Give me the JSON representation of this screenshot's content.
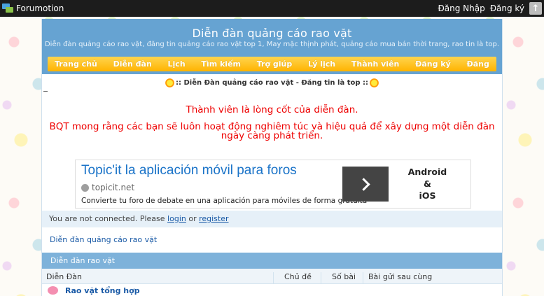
{
  "topbar": {
    "brand": "Forumotion",
    "login": "Đăng Nhập",
    "register": "Đăng ký",
    "up_symbol": "↑"
  },
  "header": {
    "title": "Diễn đàn quảng cáo rao vặt",
    "description": "Diễn đàn quảng cáo rao vặt, đăng tin quảng cáo rao vặt top 1, May mặc thịnh phát, quảng cáo mua bán thời trang, rao tin là top."
  },
  "nav": {
    "items": [
      "Trang chủ",
      "Diễn đàn",
      "Lịch",
      "Tìm kiếm",
      "Trợ giúp",
      "Lý lịch",
      "Thành viên",
      "Đăng ký",
      "Đăng"
    ]
  },
  "announce": {
    "subtitle": ":: Diễn Đàn quảng cáo rao vặt - Đăng tin là top ::",
    "line1": "Thành viên là lòng cốt của diễn đàn.",
    "line2": "BQT mong rằng các bạn sẽ luôn hoạt động nghiêm túc và hiệu quả để xây dựng một diễn đàn ngày càng phát triển."
  },
  "ad": {
    "title": "Topic'it la aplicación móvil para foros",
    "domain": "topicit.net",
    "description": "Convierte tu foro de debate en una aplicación para móviles de forma gratuita",
    "platform_line1": "Android",
    "platform_line2": "&",
    "platform_line3": "iOS"
  },
  "notice": {
    "prefix": "You are not connected. Please ",
    "login_link": "login",
    "middle": " or ",
    "register_link": "register"
  },
  "breadcrumb": "Diễn đàn quảng cáo rao vặt",
  "forum": {
    "category": "Diễn đàn rao vặt",
    "columns": [
      "Diễn Đàn",
      "Chủ đề",
      "Số bài",
      "Bài gửi sau cùng"
    ],
    "rows": [
      {
        "name": "Rao vặt tổng hợp"
      }
    ]
  },
  "colors": {
    "header_blue": "#66a3d2",
    "nav_gold": "#ffb300",
    "announce_red": "#e00000",
    "link_blue": "#1a5aa6"
  }
}
